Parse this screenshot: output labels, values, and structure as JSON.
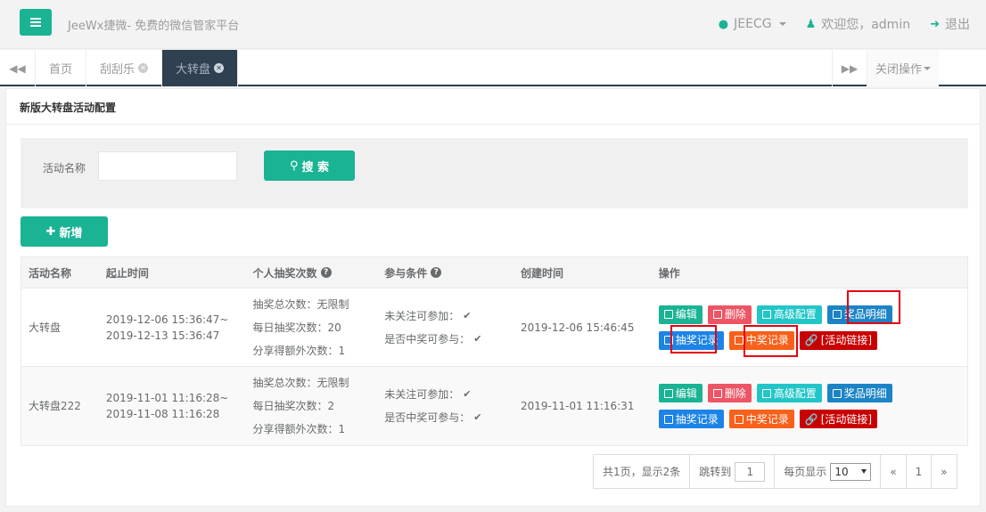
{
  "app": {
    "brand": "JeeWx捷微- 免费的微信管家平台"
  },
  "top_right": {
    "jeecg": "JEECG",
    "welcome": "欢迎您，admin",
    "logout": "退出"
  },
  "tabs": [
    {
      "label": "首页",
      "closable": false
    },
    {
      "label": "刮刮乐",
      "closable": true
    },
    {
      "label": "大转盘",
      "closable": true,
      "active": true
    }
  ],
  "close_ops": "关闭操作",
  "panel": {
    "title": "新版大转盘活动配置"
  },
  "search": {
    "label": "活动名称",
    "value": "",
    "button": "搜 索"
  },
  "add_button": "新增",
  "table": {
    "headers": [
      "活动名称",
      "起止时间",
      "个人抽奖次数",
      "参与条件",
      "创建时间",
      "操作"
    ],
    "rows": [
      {
        "name": "大转盘",
        "start": "2019-12-06 15:36:47~",
        "end": "2019-12-13 15:36:47",
        "counts": [
          "抽奖总次数：无限制",
          "每日抽奖次数：20",
          "分享得额外次数：1"
        ],
        "cond1": "未关注可参加：",
        "cond2": "是否中奖可参与：",
        "created": "2019-12-06 15:46:45"
      },
      {
        "name": "大转盘222",
        "start": "2019-11-01 11:16:28~",
        "end": "2019-11-08 11:16:28",
        "counts": [
          "抽奖总次数：无限制",
          "每日抽奖次数：2",
          "分享得额外次数：1"
        ],
        "cond1": "未关注可参加：",
        "cond2": "是否中奖可参与：",
        "created": "2019-11-01 11:16:31"
      }
    ],
    "ops": [
      "编辑",
      "删除",
      "高级配置",
      "奖品明细",
      "抽奖记录",
      "中奖记录",
      "[活动链接]"
    ]
  },
  "pager": {
    "summary": "共1页，显示2条",
    "jump_label": "跳转到",
    "jump_value": "1",
    "per_page_label": "每页显示",
    "per_page": "10",
    "prev": "«",
    "page": "1",
    "next": "»"
  },
  "colors": {
    "primary": "#1ab394",
    "tab_active": "#2f4050",
    "highlight": "#e60012"
  }
}
